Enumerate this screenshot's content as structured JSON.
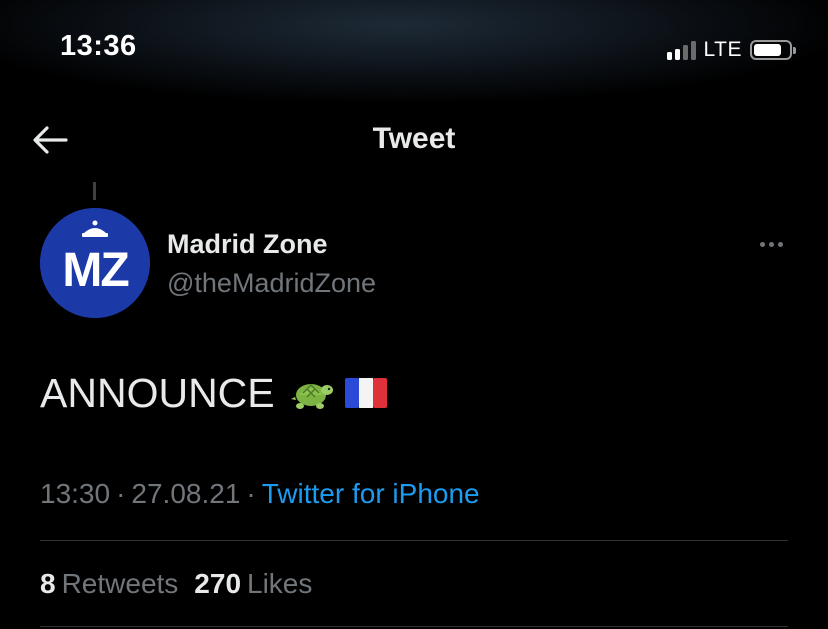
{
  "status_bar": {
    "time": "13:36",
    "network": "LTE",
    "signal_bars_active": 2,
    "signal_bars_total": 4,
    "battery_level": 0.8
  },
  "nav": {
    "title": "Tweet",
    "back_icon": "arrow-left-icon"
  },
  "author": {
    "display_name": "Madrid Zone",
    "handle": "@theMadridZone",
    "avatar_text": "MZ",
    "avatar_color": "#1b3aa8"
  },
  "tweet": {
    "text": "ANNOUNCE",
    "emojis": [
      "turtle-emoji",
      "france-flag-emoji"
    ]
  },
  "meta": {
    "time": "13:30",
    "date": "27.08.21",
    "separator": "·",
    "source": "Twitter for iPhone"
  },
  "stats": {
    "retweets_count": "8",
    "retweets_label": "Retweets",
    "likes_count": "270",
    "likes_label": "Likes"
  },
  "colors": {
    "background": "#000000",
    "text_primary": "#e7e9ea",
    "text_secondary": "#71767b",
    "link": "#1d9bf0",
    "divider": "#2f3336"
  }
}
